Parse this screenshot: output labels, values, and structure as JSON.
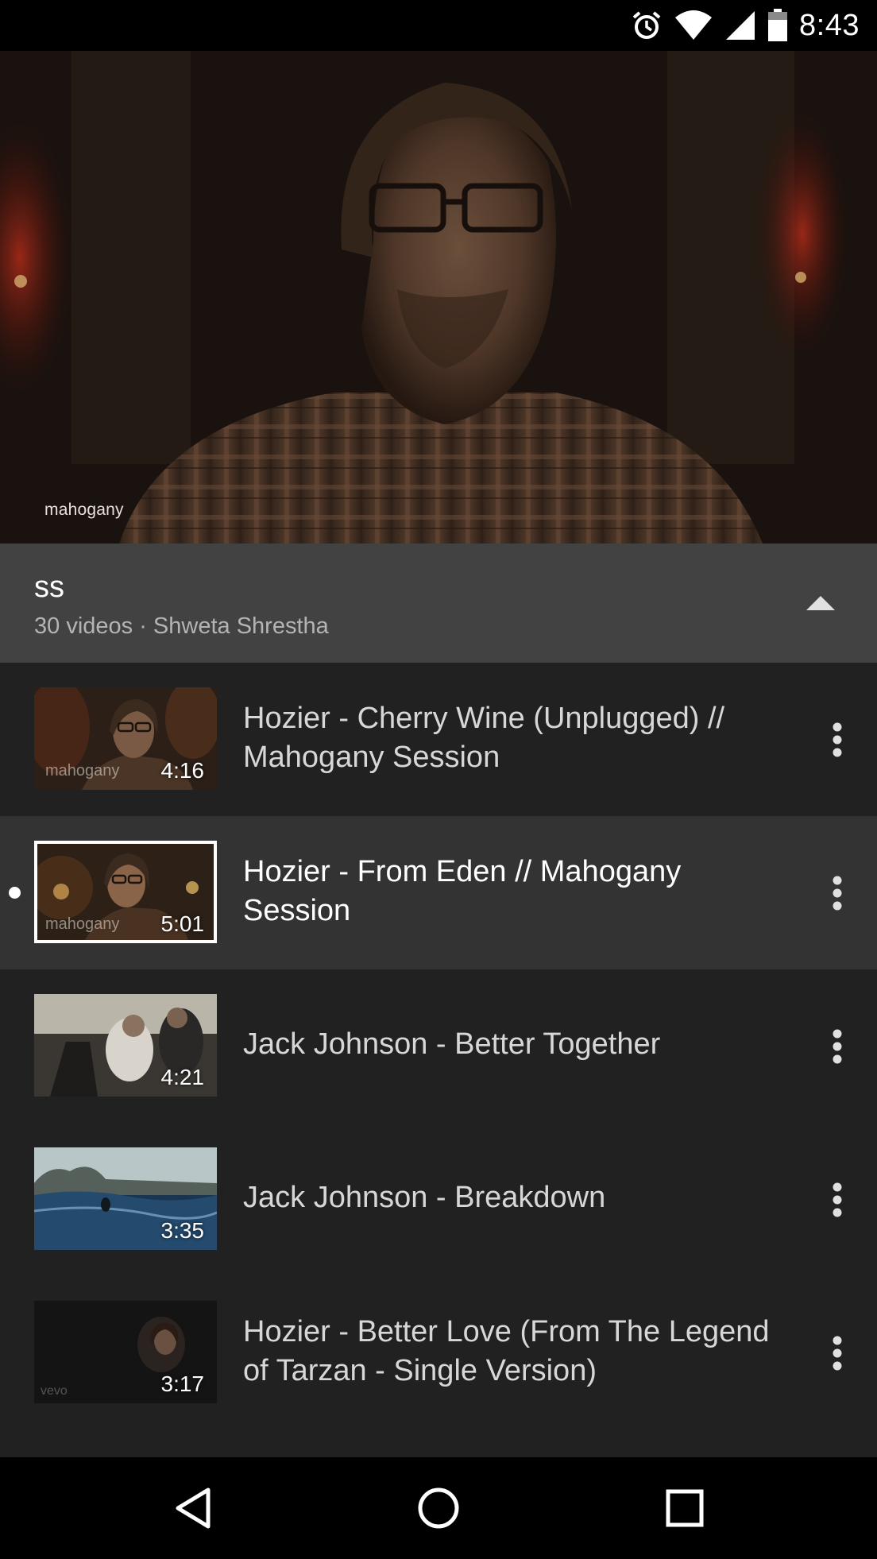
{
  "status_bar": {
    "time": "8:43",
    "icons": [
      "alarm-icon",
      "wifi-icon",
      "signal-icon",
      "battery-icon"
    ]
  },
  "player": {
    "watermark": "mahogany"
  },
  "playlist": {
    "title": "ss",
    "meta": "30 videos · Shweta Shrestha"
  },
  "videos": [
    {
      "title": "Hozier - Cherry Wine (Unplugged) // Mahogany Session",
      "duration": "4:16",
      "thumb_watermark": "mahogany"
    },
    {
      "title": "Hozier - From Eden // Mahogany Session",
      "duration": "5:01",
      "thumb_watermark": "mahogany",
      "current": true
    },
    {
      "title": "Jack Johnson - Better Together",
      "duration": "4:21"
    },
    {
      "title": "Jack Johnson - Breakdown",
      "duration": "3:35"
    },
    {
      "title": "Hozier - Better Love (From The Legend of Tarzan - Single Version)",
      "duration": "3:17",
      "thumb_watermark": "vevo"
    }
  ],
  "nav": {
    "icons": [
      "back-icon",
      "home-icon",
      "recents-icon"
    ]
  },
  "colors": {
    "header_bg": "#424242",
    "list_bg": "#212121",
    "current_row_bg": "#333333"
  }
}
